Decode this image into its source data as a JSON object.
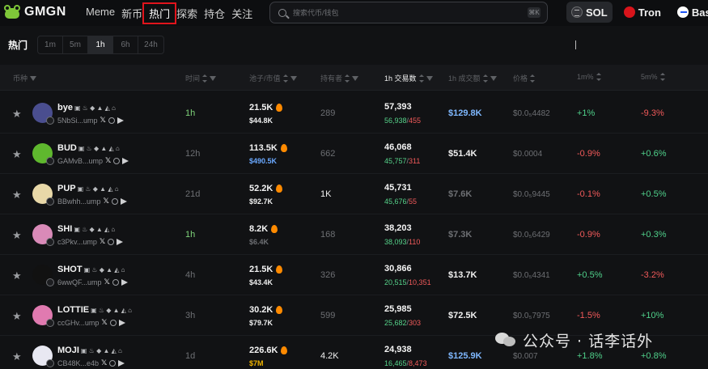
{
  "header": {
    "logo_text": "GMGN",
    "nav": [
      "Meme",
      "新币",
      "热门",
      "探索",
      "持仓",
      "关注"
    ],
    "active_nav": "热门",
    "search_placeholder": "搜索代币/钱包",
    "search_kbd": "⌘K",
    "chains": [
      {
        "label": "SOL",
        "selected": true,
        "icon": "solana-icon"
      },
      {
        "label": "Tron",
        "selected": false,
        "icon": "tron-icon"
      },
      {
        "label": "Base",
        "selected": false,
        "icon": "base-icon"
      }
    ]
  },
  "subheader": {
    "title": "热门",
    "timeframes": [
      "1m",
      "5m",
      "1h",
      "6h",
      "24h"
    ],
    "selected_timeframe": "1h"
  },
  "table": {
    "columns": [
      "币种",
      "时间",
      "池子/市值",
      "持有者",
      "1h 交易数",
      "1h 成交额",
      "价格",
      "1m%",
      "5m%"
    ],
    "rows": [
      {
        "symbol": "bye",
        "addr": "5NbSi...ump",
        "age": "1h",
        "age_color": "#7fd37a",
        "pool": "21.5K",
        "mcap": "$44.8K",
        "mcap_color": "#f0f0f0",
        "holders": "289",
        "holders_color": "#6d6f73",
        "tx": "57,393",
        "buys": "56,938",
        "sells": "455",
        "vol": "$129.8K",
        "vol_color": "#7fb8ff",
        "price": "$0.0₅4482",
        "m1": "+1%",
        "m1_cls": "pos",
        "m5": "-9.3%",
        "m5_cls": "neg",
        "avatar_color": "#4a4e8f"
      },
      {
        "symbol": "BUD",
        "addr": "GAMvB...ump",
        "age": "12h",
        "age_color": "#6d6f73",
        "pool": "113.5K",
        "mcap": "$490.5K",
        "mcap_color": "#6aa8ff",
        "holders": "662",
        "holders_color": "#6d6f73",
        "tx": "46,068",
        "buys": "45,757",
        "sells": "311",
        "vol": "$51.4K",
        "vol_color": "#f0f0f0",
        "price": "$0.0004",
        "m1": "-0.9%",
        "m1_cls": "neg",
        "m5": "+0.6%",
        "m5_cls": "pos",
        "avatar_color": "#5fb82e"
      },
      {
        "symbol": "PUP",
        "addr": "BBwhh...ump",
        "age": "21d",
        "age_color": "#6d6f73",
        "pool": "52.2K",
        "mcap": "$92.7K",
        "mcap_color": "#f0f0f0",
        "holders": "1K",
        "holders_color": "#f0f0f0",
        "tx": "45,731",
        "buys": "45,676",
        "sells": "55",
        "vol": "$7.6K",
        "vol_color": "#6d6f73",
        "price": "$0.0₅9445",
        "m1": "-0.1%",
        "m1_cls": "neg",
        "m5": "+0.5%",
        "m5_cls": "pos",
        "avatar_color": "#e8d8a8"
      },
      {
        "symbol": "SHI",
        "addr": "c3Pkv...ump",
        "age": "1h",
        "age_color": "#7fd37a",
        "pool": "8.2K",
        "mcap": "$6.4K",
        "mcap_color": "#6d6f73",
        "holders": "168",
        "holders_color": "#6d6f73",
        "tx": "38,203",
        "buys": "38,093",
        "sells": "110",
        "vol": "$7.3K",
        "vol_color": "#6d6f73",
        "price": "$0.0₅6429",
        "m1": "-0.9%",
        "m1_cls": "neg",
        "m5": "+0.3%",
        "m5_cls": "pos",
        "avatar_color": "#d98ab8"
      },
      {
        "symbol": "SHOT",
        "addr": "6wwQF...ump",
        "age": "4h",
        "age_color": "#6d6f73",
        "pool": "21.5K",
        "mcap": "$43.4K",
        "mcap_color": "#f0f0f0",
        "holders": "326",
        "holders_color": "#6d6f73",
        "tx": "30,866",
        "buys": "20,515",
        "sells": "10,351",
        "vol": "$13.7K",
        "vol_color": "#f0f0f0",
        "price": "$0.0₅4341",
        "m1": "+0.5%",
        "m1_cls": "pos",
        "m5": "-3.2%",
        "m5_cls": "neg",
        "avatar_color": "#111111"
      },
      {
        "symbol": "LOTTIE",
        "addr": "ccGHv...ump",
        "age": "3h",
        "age_color": "#6d6f73",
        "pool": "30.2K",
        "mcap": "$79.7K",
        "mcap_color": "#f0f0f0",
        "holders": "599",
        "holders_color": "#6d6f73",
        "tx": "25,985",
        "buys": "25,682",
        "sells": "303",
        "vol": "$72.5K",
        "vol_color": "#f0f0f0",
        "price": "$0.0₅7975",
        "m1": "-1.5%",
        "m1_cls": "neg",
        "m5": "+10%",
        "m5_cls": "pos",
        "avatar_color": "#e07ab0"
      },
      {
        "symbol": "MOJI",
        "addr": "CB48K...e4b",
        "age": "1d",
        "age_color": "#6d6f73",
        "pool": "226.6K",
        "mcap": "$7M",
        "mcap_color": "#f0b400",
        "holders": "4.2K",
        "holders_color": "#f0f0f0",
        "tx": "24,938",
        "buys": "16,465",
        "sells": "8,473",
        "vol": "$125.9K",
        "vol_color": "#7fb8ff",
        "price": "$0.007",
        "m1": "+1.8%",
        "m1_cls": "pos",
        "m5": "+0.8%",
        "m5_cls": "pos",
        "avatar_color": "#e8e8f2"
      }
    ]
  },
  "watermark": "公众号 · 话李话外"
}
